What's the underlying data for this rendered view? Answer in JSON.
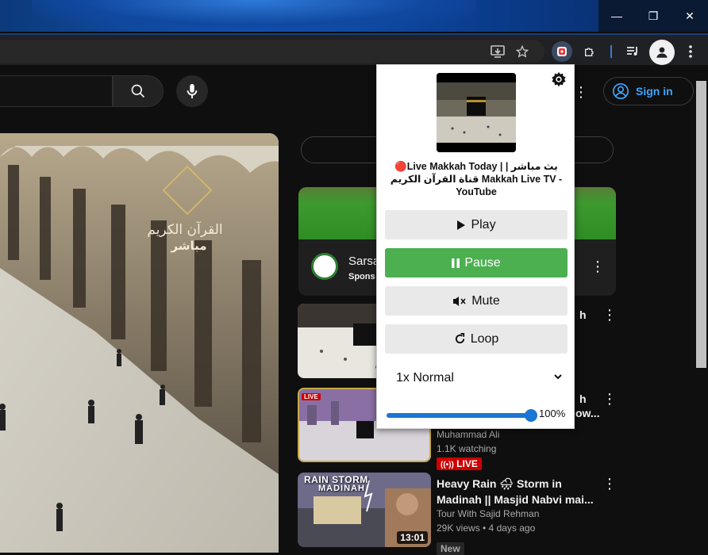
{
  "window": {
    "minimize_glyph": "—",
    "restore_glyph": "❐",
    "close_glyph": "✕"
  },
  "toolbar": {
    "icons": [
      "install-app-icon",
      "bookmark-star-icon",
      "extension-music-icon",
      "extensions-puzzle-icon",
      "media-queue-icon",
      "profile-icon",
      "menu-dots-icon"
    ]
  },
  "youtube": {
    "sign_in_label": "Sign in",
    "player_overlay": {
      "line1": "القرآن الكريم",
      "line2": "مباشر"
    },
    "ad": {
      "title": "Sarsa",
      "sponsored": "Spons"
    },
    "videos": [
      {
        "title": "h",
        "meta1": "",
        "meta2": "",
        "badge": "",
        "duration": ""
      },
      {
        "title": "h",
        "title_line2": "ow...",
        "channel": "Muhammad Ali",
        "meta": "1.1K watching",
        "badge": "LIVE",
        "thumb_badge": "LIVE"
      },
      {
        "title": "Heavy Rain 🌧 Storm in Madinah || Masjid Nabvi mai...",
        "channel": "Tour With Sajid Rehman",
        "meta": "29K views • 4 days ago",
        "badge": "New",
        "duration": "13:01",
        "thumb_text1": "RAIN STORM",
        "thumb_text2": "MADINAH"
      }
    ]
  },
  "popup": {
    "title": "🔴Live Makkah Today | بث مباشر | قناة القرآن الكريم Makkah Live TV - YouTube",
    "buttons": {
      "play": "Play",
      "pause": "Pause",
      "mute": "Mute",
      "loop": "Loop"
    },
    "speed": "1x Normal",
    "volume_label": "100%",
    "volume_fraction": 1.0,
    "colors": {
      "pause_active": "#4caf50",
      "slider": "#1976d2"
    }
  }
}
